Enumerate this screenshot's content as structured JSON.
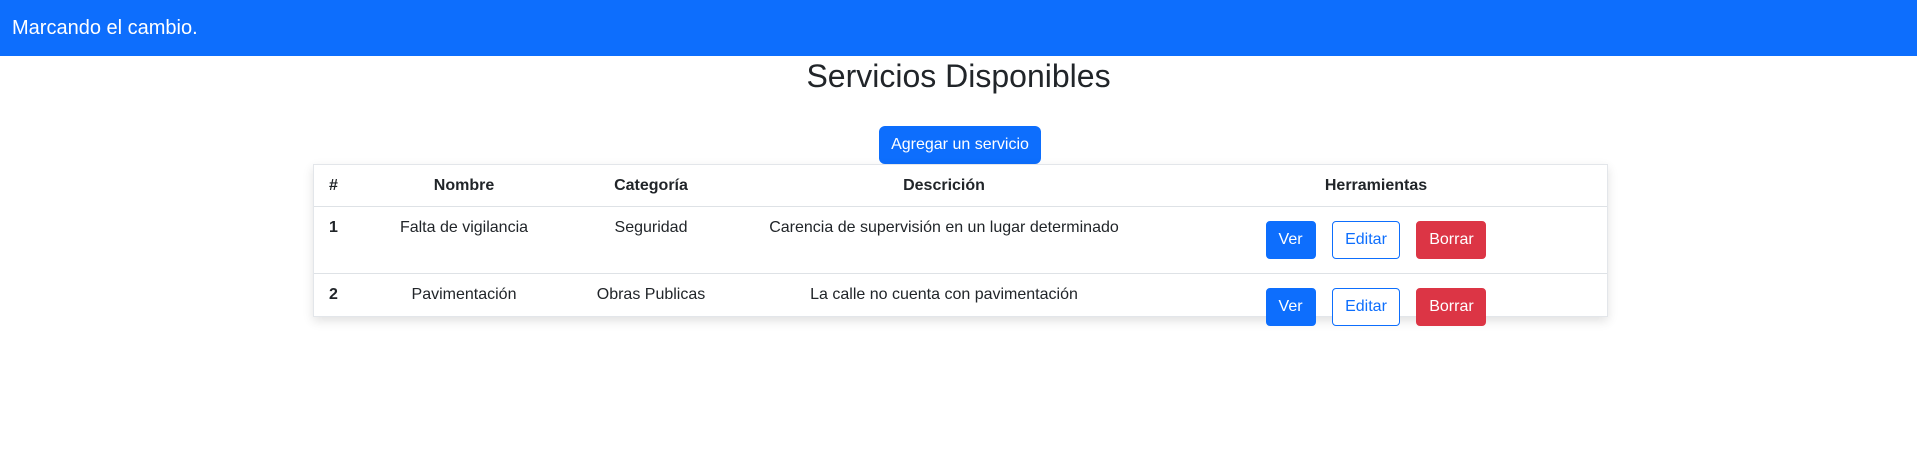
{
  "navbar": {
    "brand": "Marcando el cambio."
  },
  "page": {
    "title": "Servicios Disponibles",
    "add_button": "Agregar un servicio"
  },
  "table": {
    "headers": [
      "#",
      "Nombre",
      "Categoría",
      "Descrición",
      "Herramientas"
    ],
    "rows": [
      {
        "num": "1",
        "nombre": "Falta de vigilancia",
        "categoria": "Seguridad",
        "descripcion": "Carencia de supervisión en un lugar determinado"
      },
      {
        "num": "2",
        "nombre": "Pavimentación",
        "categoria": "Obras Publicas",
        "descripcion": "La calle no cuenta con pavimentación"
      }
    ],
    "actions": {
      "ver": "Ver",
      "editar": "Editar",
      "borrar": "Borrar"
    }
  },
  "colors": {
    "primary": "#0d6efd",
    "danger": "#dc3545",
    "text": "#212529"
  }
}
